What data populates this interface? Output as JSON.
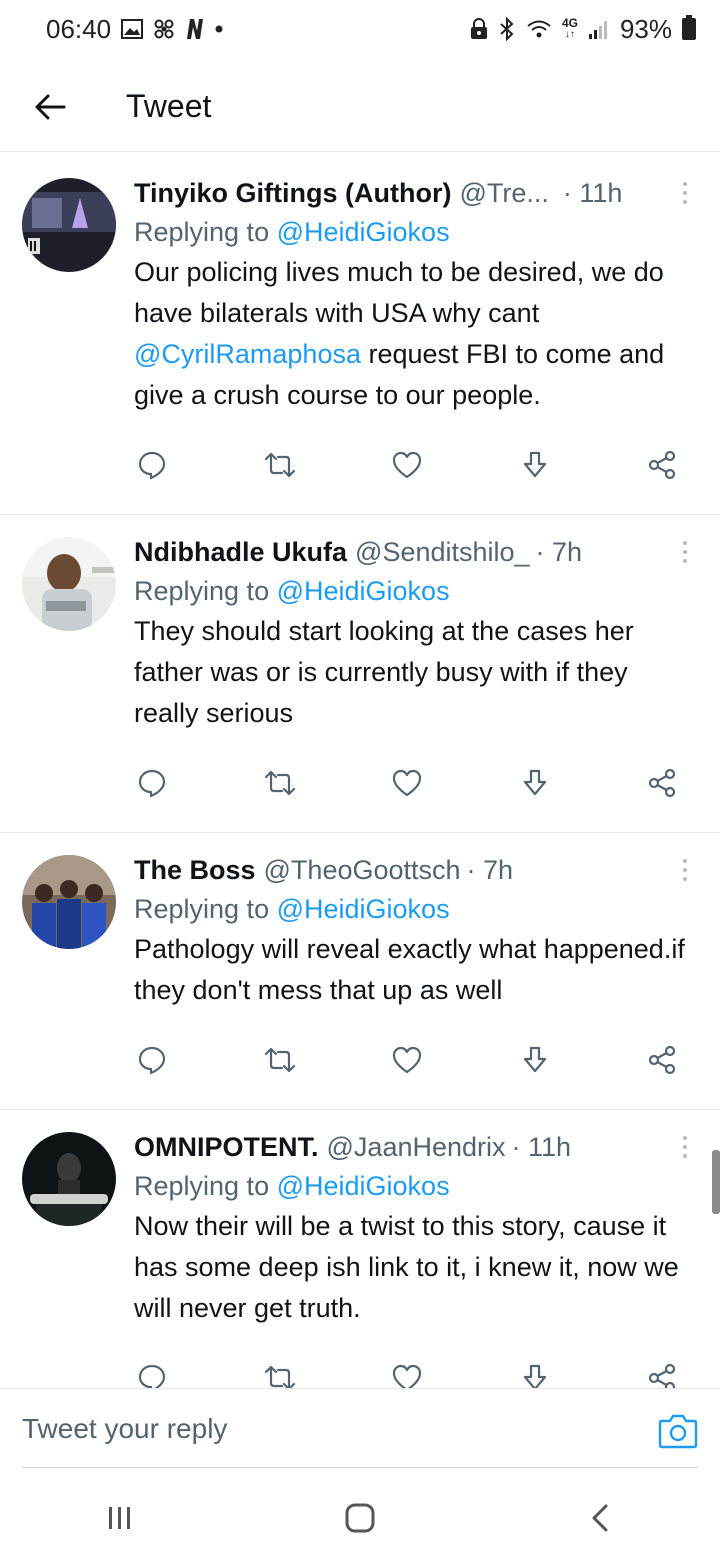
{
  "status_bar": {
    "time": "06:40",
    "network": "4G",
    "battery": "93%"
  },
  "header": {
    "title": "Tweet"
  },
  "tweets": [
    {
      "name": "Tinyiko Giftings (Author)",
      "handle": "@Tre...",
      "time": "· 11h",
      "replying_label": "Replying to",
      "replying_to": "@HeidiGiokos",
      "text_parts": [
        "Our policing lives much to be desired, we do have bilaterals with USA why cant ",
        "@CyrilRamaphosa",
        " request FBI to come and give a crush course to our people."
      ]
    },
    {
      "name": "Ndibhadle Ukufa",
      "handle": "@Senditshilo_",
      "time": "· 7h",
      "replying_label": "Replying to",
      "replying_to": "@HeidiGiokos",
      "text": "They should start looking at the cases her father was or is currently busy with if they really serious"
    },
    {
      "name": "The Boss",
      "handle": "@TheoGoottsch",
      "time": "· 7h",
      "replying_label": "Replying to",
      "replying_to": "@HeidiGiokos",
      "text": "Pathology will reveal exactly what happened.if they don't mess that up as well"
    },
    {
      "name": "OMNIPOTENT.",
      "handle": "@JaanHendrix",
      "time": "· 11h",
      "replying_label": "Replying to",
      "replying_to": "@HeidiGiokos",
      "text": "Now their will be a twist to this story, cause it has some deep ish link to it, i knew it, now we will never get truth."
    }
  ],
  "reply_bar": {
    "placeholder": "Tweet your reply"
  },
  "colors": {
    "accent": "#1d9bf0",
    "secondary_text": "#536471",
    "primary_text": "#0f1419",
    "divider": "#e6e9eb"
  },
  "icons": {
    "back": "arrow-left-icon",
    "reply": "comment-icon",
    "retweet": "retweet-icon",
    "like": "heart-icon",
    "download": "download-icon",
    "share": "share-icon",
    "camera": "camera-icon"
  }
}
